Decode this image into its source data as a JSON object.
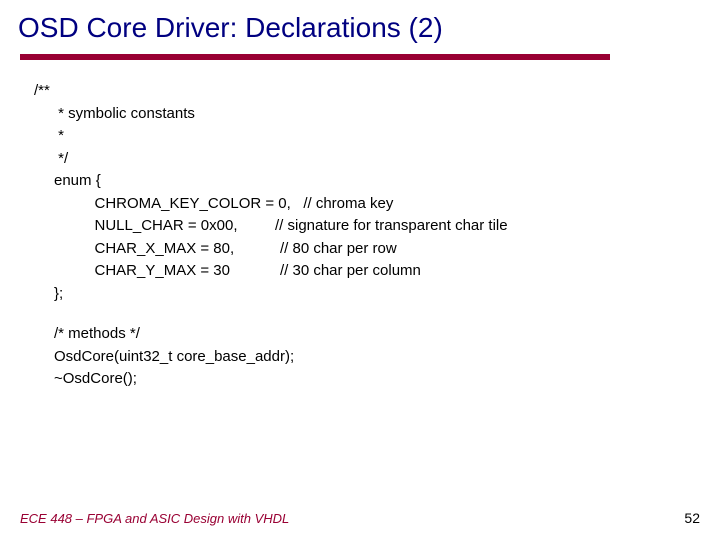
{
  "title": "OSD Core Driver: Declarations (2)",
  "code": {
    "l1": "/**",
    "l2": " * symbolic constants",
    "l3": " *",
    "l4": " */",
    "l5": "enum {",
    "l6": "   CHROMA_KEY_COLOR = 0,   // chroma key",
    "l7": "   NULL_CHAR = 0x00,         // signature for transparent char tile",
    "l8": "   CHAR_X_MAX = 80,           // 80 char per row",
    "l9": "   CHAR_Y_MAX = 30            // 30 char per column",
    "l10": "};",
    "l11": "/* methods */",
    "l12": "OsdCore(uint32_t core_base_addr);",
    "l13": "~OsdCore();"
  },
  "footer": {
    "course": "ECE 448 – FPGA and ASIC Design with VHDL",
    "page": "52"
  }
}
